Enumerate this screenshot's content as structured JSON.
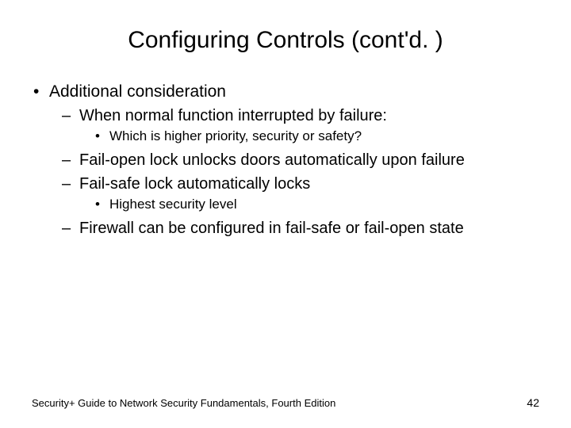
{
  "title": "Configuring Controls (cont'd. )",
  "bullets": {
    "l1": "Additional consideration",
    "l2a": "When normal function interrupted by failure:",
    "l3a": "Which is higher priority, security or safety?",
    "l2b": "Fail-open lock unlocks doors automatically upon failure",
    "l2c": "Fail-safe lock automatically locks",
    "l3b": "Highest security level",
    "l2d": "Firewall can be configured in fail-safe or fail-open state"
  },
  "footer": {
    "text": "Security+ Guide to Network Security Fundamentals, Fourth Edition",
    "page": "42"
  }
}
